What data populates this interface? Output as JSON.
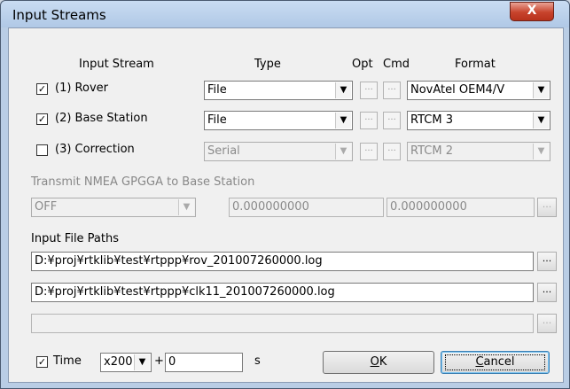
{
  "window": {
    "title": "Input Streams",
    "close_glyph": "X"
  },
  "headers": {
    "input_stream": "Input Stream",
    "type": "Type",
    "opt": "Opt",
    "cmd": "Cmd",
    "format": "Format"
  },
  "streams": [
    {
      "checked": "✓",
      "label": "(1) Rover",
      "type": "File",
      "format": "NovAtel OEM4/V"
    },
    {
      "checked": "✓",
      "label": "(2) Base Station",
      "type": "File",
      "format": "RTCM 3"
    },
    {
      "checked": "",
      "label": "(3) Correction",
      "type": "Serial",
      "format": "RTCM 2"
    }
  ],
  "nmea": {
    "label": "Transmit NMEA GPGGA to Base Station",
    "mode": "OFF",
    "lat": "0.000000000",
    "lon": "0.000000000"
  },
  "paths": {
    "label": "Input File Paths",
    "values": [
      "D:¥proj¥rtklib¥test¥rtppp¥rov_201007260000.log",
      "D:¥proj¥rtklib¥test¥rtppp¥clk11_201007260000.log",
      ""
    ]
  },
  "time": {
    "checked": "✓",
    "label": "Time",
    "speed": "x200",
    "plus": "+",
    "offset": "0",
    "unit": "s"
  },
  "buttons": {
    "ok_mnemonic": "O",
    "ok_rest": "K",
    "cancel_mnemonic": "C",
    "cancel_rest": "ancel"
  },
  "glyphs": {
    "dots": "...",
    "arrow": "▼"
  }
}
